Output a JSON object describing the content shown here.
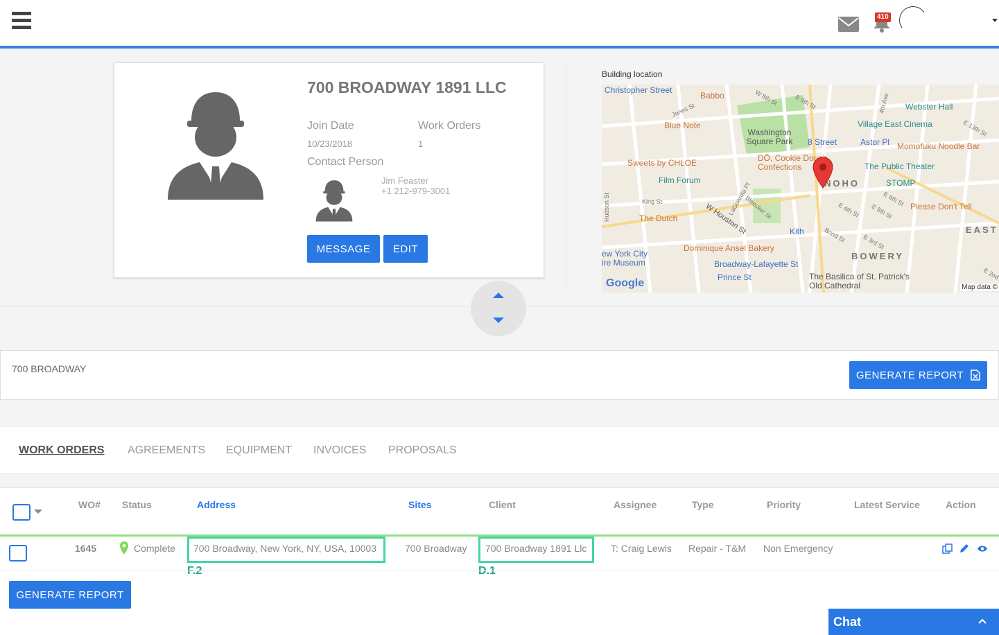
{
  "topbar": {
    "notification_count": "410"
  },
  "profile": {
    "company_name": "700 BROADWAY 1891 LLC",
    "join_date_label": "Join Date",
    "join_date": "10/23/2018",
    "work_orders_label": "Work Orders",
    "work_orders_count": "1",
    "contact_label": "Contact Person",
    "contact_name": "Jim Feaster",
    "contact_phone": "+1 212-979-3001",
    "message_label": "MESSAGE",
    "edit_label": "EDIT"
  },
  "map": {
    "title": "Building location",
    "labels": {
      "christopher": "Christopher Street",
      "babbo": "Babbo",
      "w8th": "W 8th St",
      "e9th": "E 9th St",
      "fourth_ave": "4th Ave",
      "webster": "Webster Hall",
      "jones": "Jones St",
      "bluenote": "Blue Note",
      "washington": "Washington Square Park",
      "village_east": "Village East Cinema",
      "e13th": "E 13th St",
      "eighth_street": "8 Street",
      "astor": "Astor Pl",
      "momofuku": "Momofuku Noodle Bar",
      "sweets": "Sweets by CHLOE",
      "do_cookie": "DŌ, Cookie Dough Confections",
      "public_theater": "The Public Theater",
      "film_forum": "Film Forum",
      "noho": "NOHO",
      "stomp": "STOMP",
      "king": "King St",
      "laguardia": "LaGuardia Pl",
      "bleecker": "Bleecker St",
      "e6th": "E 6th St",
      "hudson": "Hudson St",
      "e4th": "E 4th St",
      "e5th": "E 5th St",
      "please": "Please Don't Tell",
      "the_dutch": "The Dutch",
      "w_houston": "W Houston St",
      "kith": "Kith",
      "bond": "Bond St",
      "east": "EAST",
      "e3rd": "E 3rd St",
      "nyc_museum": "ew York City ire Museum",
      "dominique": "Dominique Ansel Bakery",
      "bowery": "BOWERY",
      "broadway_lafayette": "Broadway-Lafayette St",
      "prince": "Prince St",
      "basilica": "The Basilica of St. Patrick's Old Cathedral",
      "e2nd": "E 2nd",
      "google": "Google",
      "map_data": "Map data ©"
    }
  },
  "site_bar": {
    "site_name": "700 BROADWAY",
    "generate_report_label": "GENERATE REPORT"
  },
  "tabs": [
    {
      "label": "WORK ORDERS",
      "active": true
    },
    {
      "label": "AGREEMENTS",
      "active": false
    },
    {
      "label": "EQUIPMENT",
      "active": false
    },
    {
      "label": "INVOICES",
      "active": false
    },
    {
      "label": "PROPOSALS",
      "active": false
    }
  ],
  "table": {
    "columns": [
      "WO#",
      "Status",
      "Address",
      "Sites",
      "Client",
      "Assignee",
      "Type",
      "Priority",
      "Latest Service",
      "Action"
    ],
    "rows": [
      {
        "wo": "1645",
        "status": "Complete",
        "address": "700 Broadway, New York, NY, USA, 10003",
        "site": "700 Broadway",
        "client": "700 Broadway 1891 Llc",
        "assignee": "T: Craig Lewis",
        "type": "Repair - T&M",
        "priority": "Non Emergency",
        "latest_service": ""
      }
    ],
    "highlight_tags": {
      "address": "F.2",
      "client": "D.1"
    },
    "generate_report_label": "GENERATE REPORT"
  },
  "chat": {
    "label": "Chat"
  },
  "colors": {
    "accent": "#2a78e4",
    "topbar_line": "#3d7fe0",
    "row_line": "#8ee07a",
    "highlight": "#45d3ac",
    "badge": "#d8342a"
  }
}
